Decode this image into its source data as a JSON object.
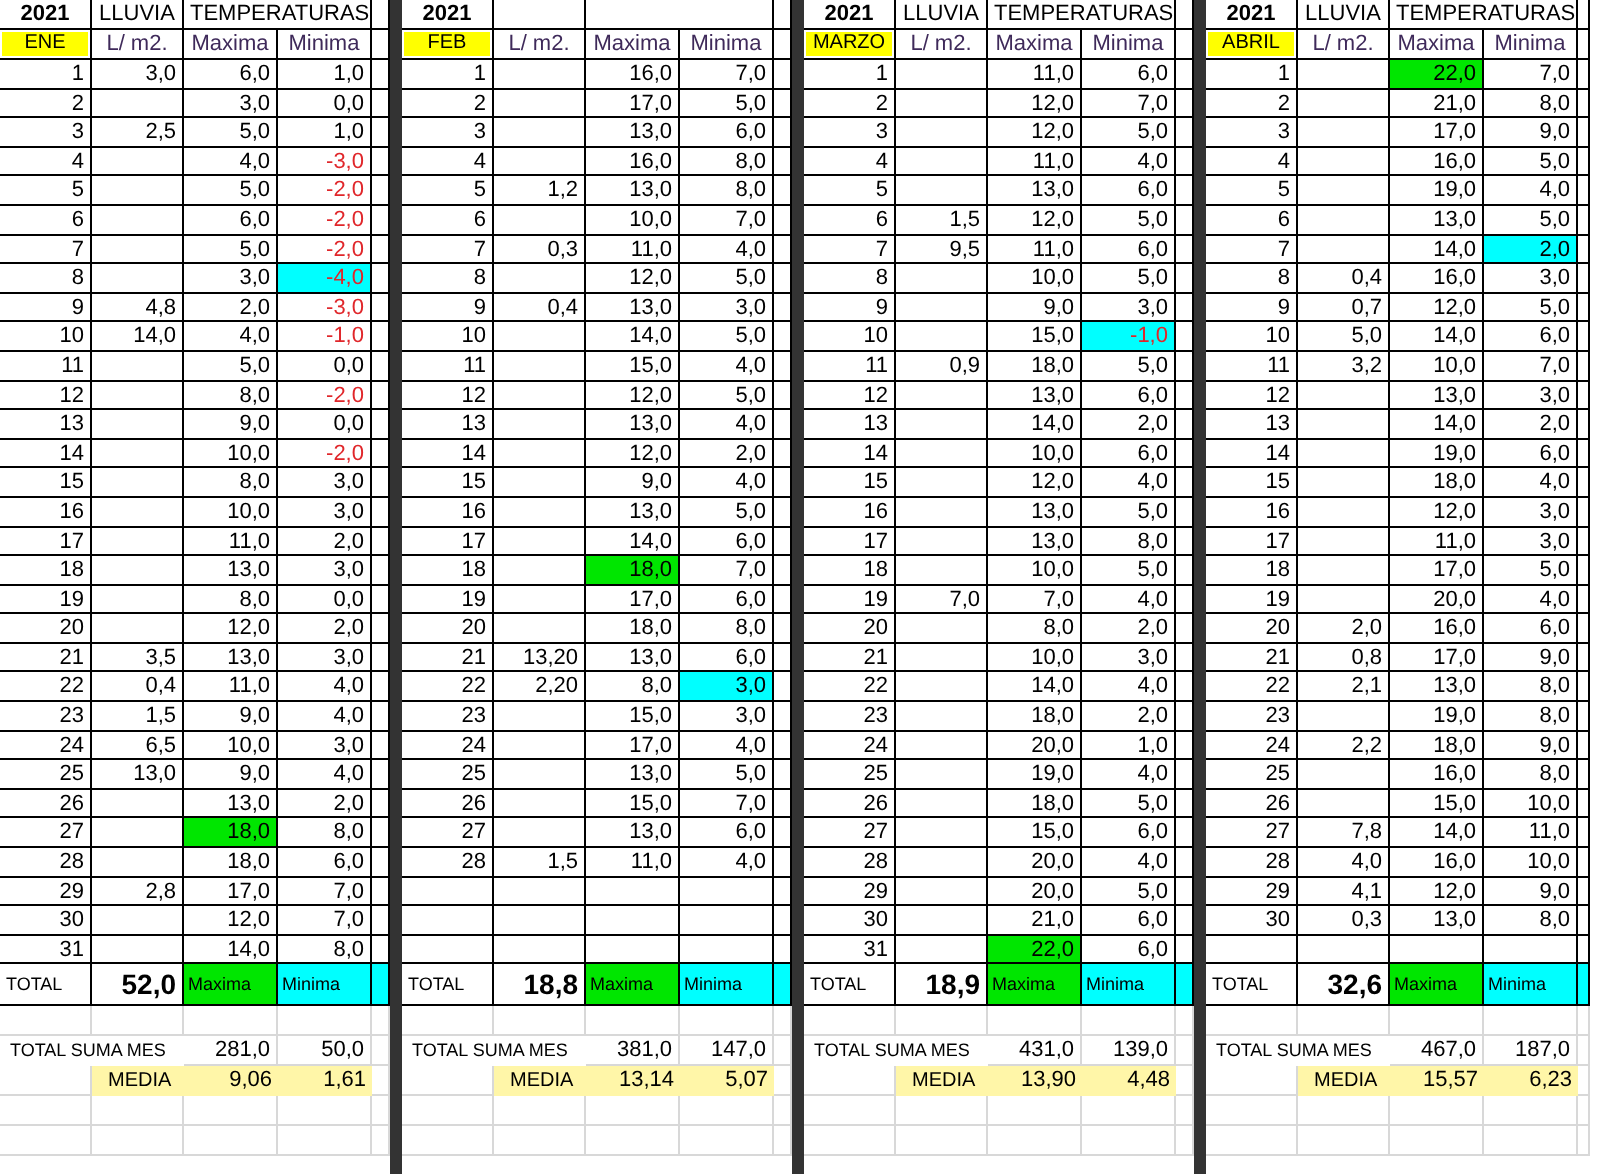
{
  "months": [
    {
      "year": "2021",
      "month": "ENE",
      "rain_header": "LLUVIA",
      "temps_header": "TEMPERATURAS",
      "unit": "L/ m2.",
      "max_header": "Maxima",
      "min_header": "Minima",
      "rows": [
        {
          "day": "1",
          "rain": "3,0",
          "max": "6,0",
          "min": "1,0",
          "max_marked": false,
          "min_marked": false,
          "red": false
        },
        {
          "day": "2",
          "max": "3,0",
          "min": "0,0",
          "max_marked": false,
          "min_marked": false,
          "red": false
        },
        {
          "day": "3",
          "rain": "2,5",
          "max": "5,0",
          "min": "1,0",
          "max_marked": false,
          "min_marked": false,
          "red": false
        },
        {
          "day": "4",
          "max": "4,0",
          "min": "-3,0",
          "max_marked": false,
          "min_marked": false,
          "red": true
        },
        {
          "day": "5",
          "max": "5,0",
          "min": "-2,0",
          "max_marked": false,
          "min_marked": false,
          "red": true
        },
        {
          "day": "6",
          "max": "6,0",
          "min": "-2,0",
          "max_marked": false,
          "min_marked": false,
          "red": true
        },
        {
          "day": "7",
          "max": "5,0",
          "min": "-2,0",
          "max_marked": false,
          "min_marked": false,
          "red": true
        },
        {
          "day": "8",
          "max": "3,0",
          "min": "-4,0",
          "max_marked": false,
          "min_marked": true,
          "red": true
        },
        {
          "day": "9",
          "rain": "4,8",
          "max": "2,0",
          "min": "-3,0",
          "max_marked": false,
          "min_marked": false,
          "red": true
        },
        {
          "day": "10",
          "rain": "14,0",
          "max": "4,0",
          "min": "-1,0",
          "max_marked": false,
          "min_marked": false,
          "red": true
        },
        {
          "day": "11",
          "max": "5,0",
          "min": "0,0",
          "max_marked": false,
          "min_marked": false,
          "red": false
        },
        {
          "day": "12",
          "max": "8,0",
          "min": "-2,0",
          "max_marked": false,
          "min_marked": false,
          "red": true
        },
        {
          "day": "13",
          "max": "9,0",
          "min": "0,0",
          "max_marked": false,
          "min_marked": false,
          "red": false
        },
        {
          "day": "14",
          "max": "10,0",
          "min": "-2,0",
          "max_marked": false,
          "min_marked": false,
          "red": true
        },
        {
          "day": "15",
          "max": "8,0",
          "min": "3,0",
          "max_marked": false,
          "min_marked": false,
          "red": false
        },
        {
          "day": "16",
          "max": "10,0",
          "min": "3,0",
          "max_marked": false,
          "min_marked": false,
          "red": false
        },
        {
          "day": "17",
          "max": "11,0",
          "min": "2,0",
          "max_marked": false,
          "min_marked": false,
          "red": false
        },
        {
          "day": "18",
          "max": "13,0",
          "min": "3,0",
          "max_marked": false,
          "min_marked": false,
          "red": false
        },
        {
          "day": "19",
          "max": "8,0",
          "min": "0,0",
          "max_marked": false,
          "min_marked": false,
          "red": false
        },
        {
          "day": "20",
          "max": "12,0",
          "min": "2,0",
          "max_marked": false,
          "min_marked": false,
          "red": false
        },
        {
          "day": "21",
          "rain": "3,5",
          "max": "13,0",
          "min": "3,0",
          "max_marked": false,
          "min_marked": false,
          "red": false
        },
        {
          "day": "22",
          "rain": "0,4",
          "max": "11,0",
          "min": "4,0",
          "max_marked": false,
          "min_marked": false,
          "red": false
        },
        {
          "day": "23",
          "rain": "1,5",
          "max": "9,0",
          "min": "4,0",
          "max_marked": false,
          "min_marked": false,
          "red": false
        },
        {
          "day": "24",
          "rain": "6,5",
          "max": "10,0",
          "min": "3,0",
          "max_marked": false,
          "min_marked": false,
          "red": false
        },
        {
          "day": "25",
          "rain": "13,0",
          "max": "9,0",
          "min": "4,0",
          "max_marked": false,
          "min_marked": false,
          "red": false
        },
        {
          "day": "26",
          "max": "13,0",
          "min": "2,0",
          "max_marked": false,
          "min_marked": false,
          "red": false
        },
        {
          "day": "27",
          "max": "18,0",
          "min": "8,0",
          "max_marked": true,
          "min_marked": false,
          "red": false
        },
        {
          "day": "28",
          "max": "18,0",
          "min": "6,0",
          "max_marked": false,
          "min_marked": false,
          "red": false
        },
        {
          "day": "29",
          "rain": "2,8",
          "max": "17,0",
          "min": "7,0",
          "max_marked": false,
          "min_marked": false,
          "red": false
        },
        {
          "day": "30",
          "max": "12,0",
          "min": "7,0",
          "max_marked": false,
          "min_marked": false,
          "red": false
        },
        {
          "day": "31",
          "max": "14,0",
          "min": "8,0",
          "max_marked": false,
          "min_marked": false,
          "red": false
        }
      ],
      "total_label": "TOTAL",
      "total_rain": "52,0",
      "total_max_label": "Maxima",
      "total_min_label": "Minima",
      "sum_label": "TOTAL SUMA MES",
      "sum_max": "281,0",
      "sum_min": "50,0",
      "avg_label": "MEDIA",
      "avg_max": "9,06",
      "avg_min": "1,61"
    },
    {
      "year": "2021",
      "month": "FEB",
      "unit": "L/ m2.",
      "max_header": "Maxima",
      "min_header": "Minima",
      "rows": [
        {
          "day": "1",
          "max": "16,0",
          "min": "7,0",
          "max_marked": false,
          "min_marked": false,
          "red": false
        },
        {
          "day": "2",
          "max": "17,0",
          "min": "5,0",
          "max_marked": false,
          "min_marked": false,
          "red": false
        },
        {
          "day": "3",
          "max": "13,0",
          "min": "6,0",
          "max_marked": false,
          "min_marked": false,
          "red": false
        },
        {
          "day": "4",
          "max": "16,0",
          "min": "8,0",
          "max_marked": false,
          "min_marked": false,
          "red": false
        },
        {
          "day": "5",
          "rain": "1,2",
          "max": "13,0",
          "min": "8,0",
          "max_marked": false,
          "min_marked": false,
          "red": false
        },
        {
          "day": "6",
          "max": "10,0",
          "min": "7,0",
          "max_marked": false,
          "min_marked": false,
          "red": false
        },
        {
          "day": "7",
          "rain": "0,3",
          "max": "11,0",
          "min": "4,0",
          "max_marked": false,
          "min_marked": false,
          "red": false
        },
        {
          "day": "8",
          "max": "12,0",
          "min": "5,0",
          "max_marked": false,
          "min_marked": false,
          "red": false
        },
        {
          "day": "9",
          "rain": "0,4",
          "max": "13,0",
          "min": "3,0",
          "max_marked": false,
          "min_marked": false,
          "red": false
        },
        {
          "day": "10",
          "max": "14,0",
          "min": "5,0",
          "max_marked": false,
          "min_marked": false,
          "red": false
        },
        {
          "day": "11",
          "max": "15,0",
          "min": "4,0",
          "max_marked": false,
          "min_marked": false,
          "red": false
        },
        {
          "day": "12",
          "max": "12,0",
          "min": "5,0",
          "max_marked": false,
          "min_marked": false,
          "red": false
        },
        {
          "day": "13",
          "max": "13,0",
          "min": "4,0",
          "max_marked": false,
          "min_marked": false,
          "red": false
        },
        {
          "day": "14",
          "max": "12,0",
          "min": "2,0",
          "max_marked": false,
          "min_marked": false,
          "red": false
        },
        {
          "day": "15",
          "max": "9,0",
          "min": "4,0",
          "max_marked": false,
          "min_marked": false,
          "red": false
        },
        {
          "day": "16",
          "max": "13,0",
          "min": "5,0",
          "max_marked": false,
          "min_marked": false,
          "red": false
        },
        {
          "day": "17",
          "max": "14,0",
          "min": "6,0",
          "max_marked": false,
          "min_marked": false,
          "red": false
        },
        {
          "day": "18",
          "max": "18,0",
          "min": "7,0",
          "max_marked": true,
          "min_marked": false,
          "red": false
        },
        {
          "day": "19",
          "max": "17,0",
          "min": "6,0",
          "max_marked": false,
          "min_marked": false,
          "red": false
        },
        {
          "day": "20",
          "max": "18,0",
          "min": "8,0",
          "max_marked": false,
          "min_marked": false,
          "red": false
        },
        {
          "day": "21",
          "rain": "13,20",
          "max": "13,0",
          "min": "6,0",
          "max_marked": false,
          "min_marked": false,
          "red": false
        },
        {
          "day": "22",
          "rain": "2,20",
          "max": "8,0",
          "min": "3,0",
          "max_marked": false,
          "min_marked": true,
          "red": false
        },
        {
          "day": "23",
          "max": "15,0",
          "min": "3,0",
          "max_marked": false,
          "min_marked": false,
          "red": false
        },
        {
          "day": "24",
          "max": "17,0",
          "min": "4,0",
          "max_marked": false,
          "min_marked": false,
          "red": false
        },
        {
          "day": "25",
          "max": "13,0",
          "min": "5,0",
          "max_marked": false,
          "min_marked": false,
          "red": false
        },
        {
          "day": "26",
          "max": "15,0",
          "min": "7,0",
          "max_marked": false,
          "min_marked": false,
          "red": false
        },
        {
          "day": "27",
          "max": "13,0",
          "min": "6,0",
          "max_marked": false,
          "min_marked": false,
          "red": false
        },
        {
          "day": "28",
          "rain": "1,5",
          "max": "11,0",
          "min": "4,0",
          "max_marked": false,
          "min_marked": false,
          "red": false
        }
      ],
      "total_label": "TOTAL",
      "total_rain": "18,8",
      "total_max_label": "Maxima",
      "total_min_label": "Minima",
      "sum_label": "TOTAL SUMA MES",
      "sum_max": "381,0",
      "sum_min": "147,0",
      "avg_label": "MEDIA",
      "avg_max": "13,14",
      "avg_min": "5,07"
    },
    {
      "year": "2021",
      "month": "MARZO",
      "rain_header": "LLUVIA",
      "temps_header": "TEMPERATURAS",
      "unit": "L/ m2.",
      "max_header": "Maxima",
      "min_header": "Minima",
      "rows": [
        {
          "day": "1",
          "max": "11,0",
          "min": "6,0",
          "max_marked": false,
          "min_marked": false,
          "red": false
        },
        {
          "day": "2",
          "max": "12,0",
          "min": "7,0",
          "max_marked": false,
          "min_marked": false,
          "red": false
        },
        {
          "day": "3",
          "max": "12,0",
          "min": "5,0",
          "max_marked": false,
          "min_marked": false,
          "red": false
        },
        {
          "day": "4",
          "max": "11,0",
          "min": "4,0",
          "max_marked": false,
          "min_marked": false,
          "red": false
        },
        {
          "day": "5",
          "max": "13,0",
          "min": "6,0",
          "max_marked": false,
          "min_marked": false,
          "red": false
        },
        {
          "day": "6",
          "rain": "1,5",
          "max": "12,0",
          "min": "5,0",
          "max_marked": false,
          "min_marked": false,
          "red": false
        },
        {
          "day": "7",
          "rain": "9,5",
          "max": "11,0",
          "min": "6,0",
          "max_marked": false,
          "min_marked": false,
          "red": false
        },
        {
          "day": "8",
          "max": "10,0",
          "min": "5,0",
          "max_marked": false,
          "min_marked": false,
          "red": false
        },
        {
          "day": "9",
          "max": "9,0",
          "min": "3,0",
          "max_marked": false,
          "min_marked": false,
          "red": false
        },
        {
          "day": "10",
          "max": "15,0",
          "min": "-1,0",
          "max_marked": false,
          "min_marked": true,
          "red": true
        },
        {
          "day": "11",
          "rain": "0,9",
          "max": "18,0",
          "min": "5,0",
          "max_marked": false,
          "min_marked": false,
          "red": false
        },
        {
          "day": "12",
          "max": "13,0",
          "min": "6,0",
          "max_marked": false,
          "min_marked": false,
          "red": false
        },
        {
          "day": "13",
          "max": "14,0",
          "min": "2,0",
          "max_marked": false,
          "min_marked": false,
          "red": false
        },
        {
          "day": "14",
          "max": "10,0",
          "min": "6,0",
          "max_marked": false,
          "min_marked": false,
          "red": false
        },
        {
          "day": "15",
          "max": "12,0",
          "min": "4,0",
          "max_marked": false,
          "min_marked": false,
          "red": false
        },
        {
          "day": "16",
          "max": "13,0",
          "min": "5,0",
          "max_marked": false,
          "min_marked": false,
          "red": false
        },
        {
          "day": "17",
          "max": "13,0",
          "min": "8,0",
          "max_marked": false,
          "min_marked": false,
          "red": false
        },
        {
          "day": "18",
          "max": "10,0",
          "min": "5,0",
          "max_marked": false,
          "min_marked": false,
          "red": false
        },
        {
          "day": "19",
          "rain": "7,0",
          "max": "7,0",
          "min": "4,0",
          "max_marked": false,
          "min_marked": false,
          "red": false
        },
        {
          "day": "20",
          "max": "8,0",
          "min": "2,0",
          "max_marked": false,
          "min_marked": false,
          "red": false
        },
        {
          "day": "21",
          "max": "10,0",
          "min": "3,0",
          "max_marked": false,
          "min_marked": false,
          "red": false
        },
        {
          "day": "22",
          "max": "14,0",
          "min": "4,0",
          "max_marked": false,
          "min_marked": false,
          "red": false
        },
        {
          "day": "23",
          "max": "18,0",
          "min": "2,0",
          "max_marked": false,
          "min_marked": false,
          "red": false
        },
        {
          "day": "24",
          "max": "20,0",
          "min": "1,0",
          "max_marked": false,
          "min_marked": false,
          "red": false
        },
        {
          "day": "25",
          "max": "19,0",
          "min": "4,0",
          "max_marked": false,
          "min_marked": false,
          "red": false
        },
        {
          "day": "26",
          "max": "18,0",
          "min": "5,0",
          "max_marked": false,
          "min_marked": false,
          "red": false
        },
        {
          "day": "27",
          "max": "15,0",
          "min": "6,0",
          "max_marked": false,
          "min_marked": false,
          "red": false
        },
        {
          "day": "28",
          "max": "20,0",
          "min": "4,0",
          "max_marked": false,
          "min_marked": false,
          "red": false
        },
        {
          "day": "29",
          "max": "20,0",
          "min": "5,0",
          "max_marked": false,
          "min_marked": false,
          "red": false
        },
        {
          "day": "30",
          "max": "21,0",
          "min": "6,0",
          "max_marked": false,
          "min_marked": false,
          "red": false
        },
        {
          "day": "31",
          "max": "22,0",
          "min": "6,0",
          "max_marked": true,
          "min_marked": false,
          "red": false
        }
      ],
      "total_label": "TOTAL",
      "total_rain": "18,9",
      "total_max_label": "Maxima",
      "total_min_label": "Minima",
      "sum_label": "TOTAL SUMA MES",
      "sum_max": "431,0",
      "sum_min": "139,0",
      "avg_label": "MEDIA",
      "avg_max": "13,90",
      "avg_min": "4,48"
    },
    {
      "year": "2021",
      "month": "ABRIL",
      "rain_header": "LLUVIA",
      "temps_header": "TEMPERATURAS",
      "unit": "L/ m2.",
      "max_header": "Maxima",
      "min_header": "Minima",
      "rows": [
        {
          "day": "1",
          "max": "22,0",
          "min": "7,0",
          "max_marked": true,
          "min_marked": false,
          "red": false
        },
        {
          "day": "2",
          "max": "21,0",
          "min": "8,0",
          "max_marked": false,
          "min_marked": false,
          "red": false
        },
        {
          "day": "3",
          "max": "17,0",
          "min": "9,0",
          "max_marked": false,
          "min_marked": false,
          "red": false
        },
        {
          "day": "4",
          "max": "16,0",
          "min": "5,0",
          "max_marked": false,
          "min_marked": false,
          "red": false
        },
        {
          "day": "5",
          "max": "19,0",
          "min": "4,0",
          "max_marked": false,
          "min_marked": false,
          "red": false
        },
        {
          "day": "6",
          "max": "13,0",
          "min": "5,0",
          "max_marked": false,
          "min_marked": false,
          "red": false
        },
        {
          "day": "7",
          "max": "14,0",
          "min": "2,0",
          "max_marked": false,
          "min_marked": true,
          "red": false
        },
        {
          "day": "8",
          "rain": "0,4",
          "max": "16,0",
          "min": "3,0",
          "max_marked": false,
          "min_marked": false,
          "red": false
        },
        {
          "day": "9",
          "rain": "0,7",
          "max": "12,0",
          "min": "5,0",
          "max_marked": false,
          "min_marked": false,
          "red": false
        },
        {
          "day": "10",
          "rain": "5,0",
          "max": "14,0",
          "min": "6,0",
          "max_marked": false,
          "min_marked": false,
          "red": false
        },
        {
          "day": "11",
          "rain": "3,2",
          "max": "10,0",
          "min": "7,0",
          "max_marked": false,
          "min_marked": false,
          "red": false
        },
        {
          "day": "12",
          "max": "13,0",
          "min": "3,0",
          "max_marked": false,
          "min_marked": false,
          "red": false
        },
        {
          "day": "13",
          "max": "14,0",
          "min": "2,0",
          "max_marked": false,
          "min_marked": false,
          "red": false
        },
        {
          "day": "14",
          "max": "19,0",
          "min": "6,0",
          "max_marked": false,
          "min_marked": false,
          "red": false
        },
        {
          "day": "15",
          "max": "18,0",
          "min": "4,0",
          "max_marked": false,
          "min_marked": false,
          "red": false
        },
        {
          "day": "16",
          "max": "12,0",
          "min": "3,0",
          "max_marked": false,
          "min_marked": false,
          "red": false
        },
        {
          "day": "17",
          "max": "11,0",
          "min": "3,0",
          "max_marked": false,
          "min_marked": false,
          "red": false
        },
        {
          "day": "18",
          "max": "17,0",
          "min": "5,0",
          "max_marked": false,
          "min_marked": false,
          "red": false
        },
        {
          "day": "19",
          "max": "20,0",
          "min": "4,0",
          "max_marked": false,
          "min_marked": false,
          "red": false
        },
        {
          "day": "20",
          "rain": "2,0",
          "max": "16,0",
          "min": "6,0",
          "max_marked": false,
          "min_marked": false,
          "red": false
        },
        {
          "day": "21",
          "rain": "0,8",
          "max": "17,0",
          "min": "9,0",
          "max_marked": false,
          "min_marked": false,
          "red": false
        },
        {
          "day": "22",
          "rain": "2,1",
          "max": "13,0",
          "min": "8,0",
          "max_marked": false,
          "min_marked": false,
          "red": false
        },
        {
          "day": "23",
          "max": "19,0",
          "min": "8,0",
          "max_marked": false,
          "min_marked": false,
          "red": false
        },
        {
          "day": "24",
          "rain": "2,2",
          "max": "18,0",
          "min": "9,0",
          "max_marked": false,
          "min_marked": false,
          "red": false
        },
        {
          "day": "25",
          "max": "16,0",
          "min": "8,0",
          "max_marked": false,
          "min_marked": false,
          "red": false
        },
        {
          "day": "26",
          "max": "15,0",
          "min": "10,0",
          "max_marked": false,
          "min_marked": false,
          "red": false
        },
        {
          "day": "27",
          "rain": "7,8",
          "max": "14,0",
          "min": "11,0",
          "max_marked": false,
          "min_marked": false,
          "red": false
        },
        {
          "day": "28",
          "rain": "4,0",
          "max": "16,0",
          "min": "10,0",
          "max_marked": false,
          "min_marked": false,
          "red": false
        },
        {
          "day": "29",
          "rain": "4,1",
          "max": "12,0",
          "min": "9,0",
          "max_marked": false,
          "min_marked": false,
          "red": false
        },
        {
          "day": "30",
          "rain": "0,3",
          "max": "13,0",
          "min": "8,0",
          "max_marked": false,
          "min_marked": false,
          "red": false
        }
      ],
      "total_label": "TOTAL",
      "total_rain": "32,6",
      "total_max_label": "Maxima",
      "total_min_label": "Minima",
      "sum_label": "TOTAL SUMA MES",
      "sum_max": "467,0",
      "sum_min": "187,0",
      "avg_label": "MEDIA",
      "avg_max": "15,57",
      "avg_min": "6,23"
    }
  ]
}
